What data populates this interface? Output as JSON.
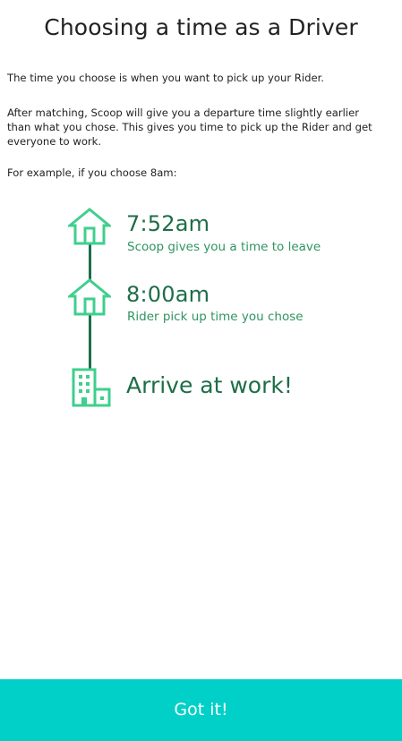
{
  "header": {
    "title": "Choosing a time as a Driver"
  },
  "intro": {
    "p1": "The time you choose is when you want to pick up your Rider.",
    "p2": "After matching, Scoop will give you a departure time slightly earlier than what you chose. This gives you time to pick up the Rider and get everyone to work.",
    "p3": "For example, if you choose 8am:"
  },
  "timeline": {
    "items": [
      {
        "icon": "home-icon",
        "time": "7:52am",
        "caption": "Scoop gives you a time to leave"
      },
      {
        "icon": "home-icon",
        "time": "8:00am",
        "caption": "Rider pick up time you chose"
      },
      {
        "icon": "office-building-icon",
        "time": "Arrive at work!"
      }
    ]
  },
  "footer": {
    "button_label": "Got it!"
  },
  "colors": {
    "accent_dark": "#1d6e47",
    "accent_text": "#2f9460",
    "icon_green": "#3fcf8e",
    "button_bg": "#00d0c7",
    "button_text": "#ffffff"
  }
}
